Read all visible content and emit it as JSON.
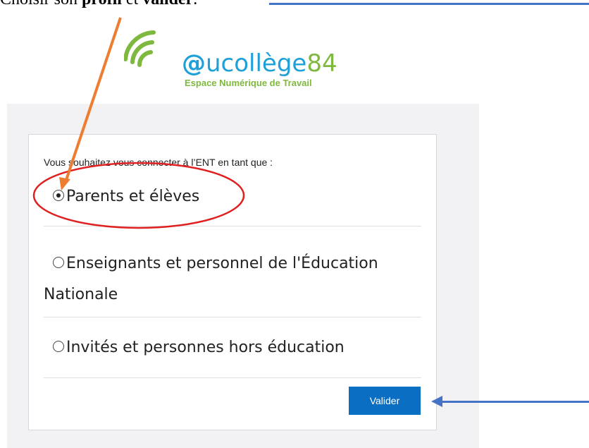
{
  "instruction": {
    "prefix": "Choisir son ",
    "profile": "profil",
    "middle": " et ",
    "validate": "valider",
    "suffix": "."
  },
  "logo": {
    "at": "@",
    "college": "ucollège",
    "number": "84",
    "subtitle": "Espace Numérique de Travail"
  },
  "form": {
    "question": "Vous souhaitez vous connecter à l’ENT en tant que :",
    "options": [
      {
        "label": "Parents et élèves",
        "selected": true
      },
      {
        "label": "Enseignants et personnel de l'Éducation Nationale",
        "selected": false
      },
      {
        "label": "Invités et personnes hors éducation",
        "selected": false
      }
    ],
    "submit_label": "Valider"
  },
  "colors": {
    "annotation_orange": "#ed7d31",
    "annotation_red": "#e02020",
    "annotation_blue": "#4472c4",
    "button_blue": "#0a6fc2",
    "logo_blue": "#1ea0d8",
    "logo_green": "#7fb83e"
  }
}
